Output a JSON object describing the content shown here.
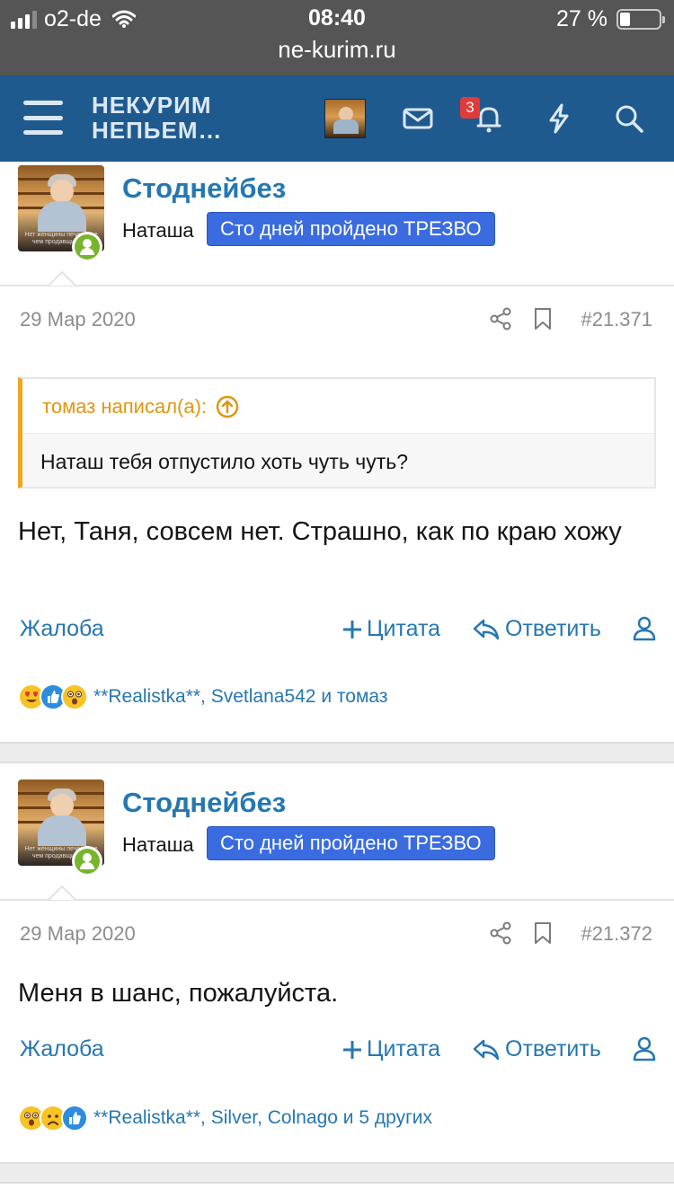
{
  "status_bar": {
    "carrier": "o2-de",
    "time": "08:40",
    "battery": "27 %",
    "battery_level": 0.27,
    "url": "ne-kurim.ru"
  },
  "header": {
    "logo_line1": "НЕКУРИМ",
    "logo_line2": "НЕПЬЕМ…",
    "notification_count": "3",
    "brand_color": "#1f5a8f"
  },
  "posts": [
    {
      "username": "Стоднейбез",
      "realname": "Наташа",
      "badge": "Сто дней пройдено ТРЕЗВО",
      "date": "29 Мар 2020",
      "number": "#21.371",
      "quote_author": "томаз написал(а):",
      "quote_text": "Наташ тебя отпустило хоть чуть чуть?",
      "message": "Нет, Таня, совсем нет. Страшно, как по краю хожу",
      "actions": {
        "report": "Жалоба",
        "quote": "Цитата",
        "reply": "Ответить"
      },
      "reactions": [
        "heart-eyes",
        "like",
        "wow"
      ],
      "reactors": "**Realistka**, Svetlana542 и томаз"
    },
    {
      "username": "Стоднейбез",
      "realname": "Наташа",
      "badge": "Сто дней пройдено ТРЕЗВО",
      "date": "29 Мар 2020",
      "number": "#21.372",
      "message": "Меня в шанс, пожалуйста.",
      "actions": {
        "report": "Жалоба",
        "quote": "Цитата",
        "reply": "Ответить"
      },
      "reactions": [
        "wow",
        "sad",
        "like"
      ],
      "reactors": "**Realistka**, Silver, Colnago и 5 других"
    }
  ]
}
